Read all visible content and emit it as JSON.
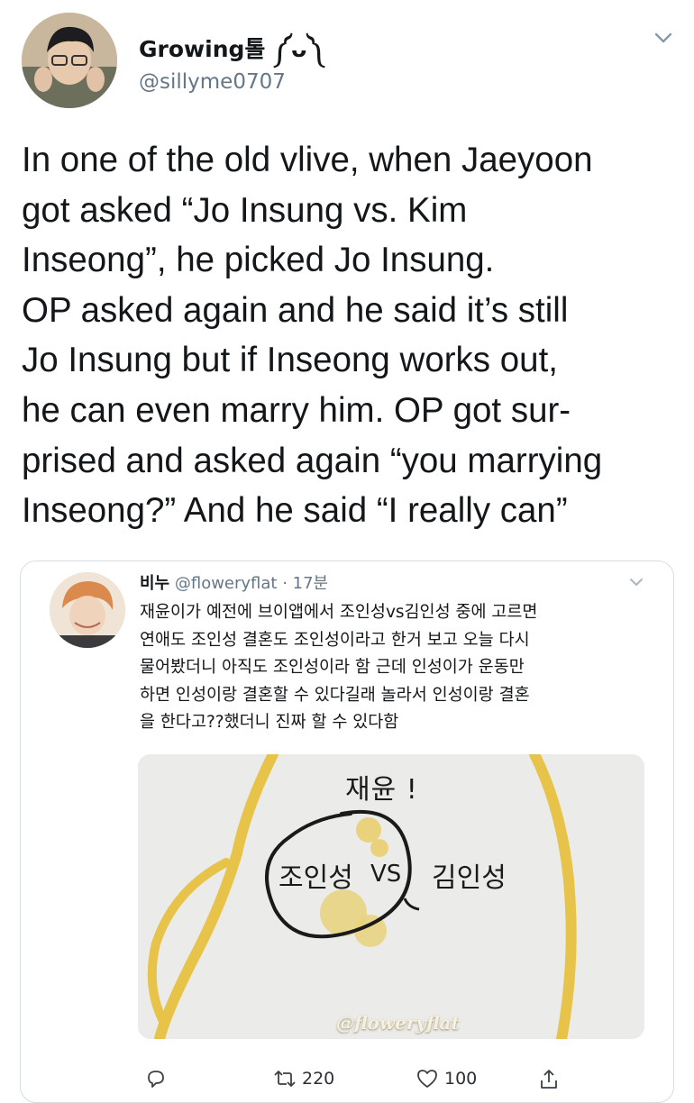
{
  "tweet": {
    "display_name": "Growing톨 ༼ᴗ༽",
    "handle": "@sillyme0707",
    "text_lines": [
      "In one of the old vlive, when Jaeyoon",
      "got asked “Jo Insung vs. Kim",
      "Inseong”, he picked Jo Insung.",
      "OP asked again and he said it’s still",
      "Jo Insung but if Inseong works out,",
      "he can even marry him. OP got sur-",
      "prised and asked again “you marrying",
      "Inseong?” And he said “I really can”"
    ]
  },
  "quoted": {
    "name": "비누",
    "handle_time": "@floweryflat · 17분",
    "text_lines": [
      "재윤이가 예전에 브이앱에서 조인성vs김인성 중에 고르면",
      "연애도 조인성 결혼도 조인성이라고 한거 보고 오늘 다시",
      "물어봤더니 아직도 조인성이라 함 근데 인성이가 운동만",
      "하면 인성이랑 결혼할 수 있다길래 놀라서 인성이랑 결혼",
      "을 한다고??했더니 진짜 할 수 있다함"
    ],
    "photo": {
      "heading": "재윤 !",
      "choice_left": "조인성",
      "vs": "VS",
      "choice_right": "김인성",
      "watermark": "@floweryflat"
    }
  },
  "actions": {
    "reply_count": "",
    "retweet_count": "220",
    "like_count": "100"
  },
  "icons": [
    "chevron-down-icon",
    "reply-icon",
    "retweet-icon",
    "like-icon",
    "share-icon"
  ],
  "colors": {
    "text": "#14171a",
    "muted": "#657786",
    "border": "#d7dde2",
    "highlight": "#e8c34a"
  }
}
